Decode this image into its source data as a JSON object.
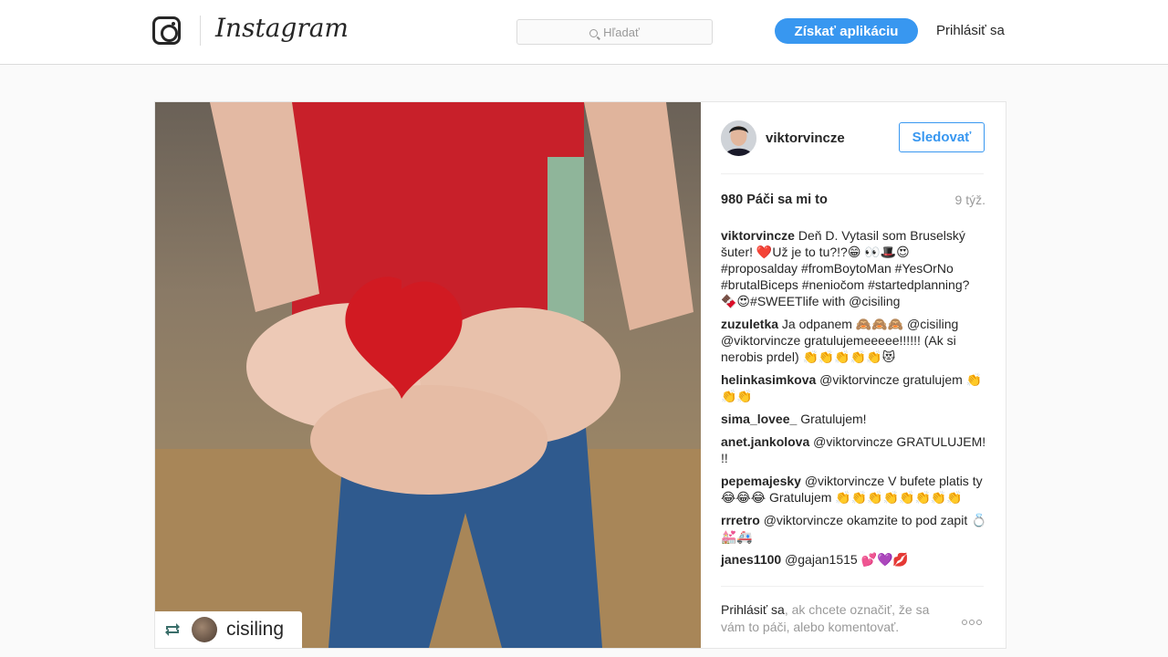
{
  "header": {
    "brand": "Instagram",
    "search_placeholder": "Hľadať",
    "get_app_label": "Získať aplikáciu",
    "login_label": "Prihlásiť sa"
  },
  "post": {
    "repost_user": "cisiling",
    "author": "viktorvincze",
    "follow_label": "Sledovať",
    "likes": "980 Páči sa mi to",
    "age": "9 týž.",
    "comments": [
      {
        "user": "viktorvincze",
        "text": "Deň D. Vytasil som Bruselský šuter! ❤️Už je to tu?!?😁 👀🎩😍 #proposalday #fromBoytoMan #YesOrNo #brutalBiceps #nenioc̆om #startedplanning? 🍫😍#SWEETlife with @cisiling"
      },
      {
        "user": "zuzuletka",
        "text": "Ja odpanem 🙈🙈🙈 @cisiling @viktorvincze gratulujemeeeee!!!!!! (Ak si nerobis prdel) 👏👏👏👏👏😻"
      },
      {
        "user": "helinkasimkova",
        "text": "@viktorvincze gratulujem 👏👏👏"
      },
      {
        "user": "sima_lovee_",
        "text": "Gratulujem!"
      },
      {
        "user": "anet.jankolova",
        "text": "@viktorvincze GRATULUJEM! !!"
      },
      {
        "user": "pepemajesky",
        "text": "@viktorvincze V bufete platis ty 😂😂😂 Gratulujem 👏👏👏👏👏👏👏👏"
      },
      {
        "user": "rrretro",
        "text": "@viktorvincze okamzite to pod zapit 💍💒🚑"
      },
      {
        "user": "janes1100",
        "text": "@gajan1515 💕💜💋"
      }
    ],
    "footer_login": "Prihlásiť sa",
    "footer_rest": ", ak chcete označiť, že sa vám to páči, alebo komentovať."
  }
}
